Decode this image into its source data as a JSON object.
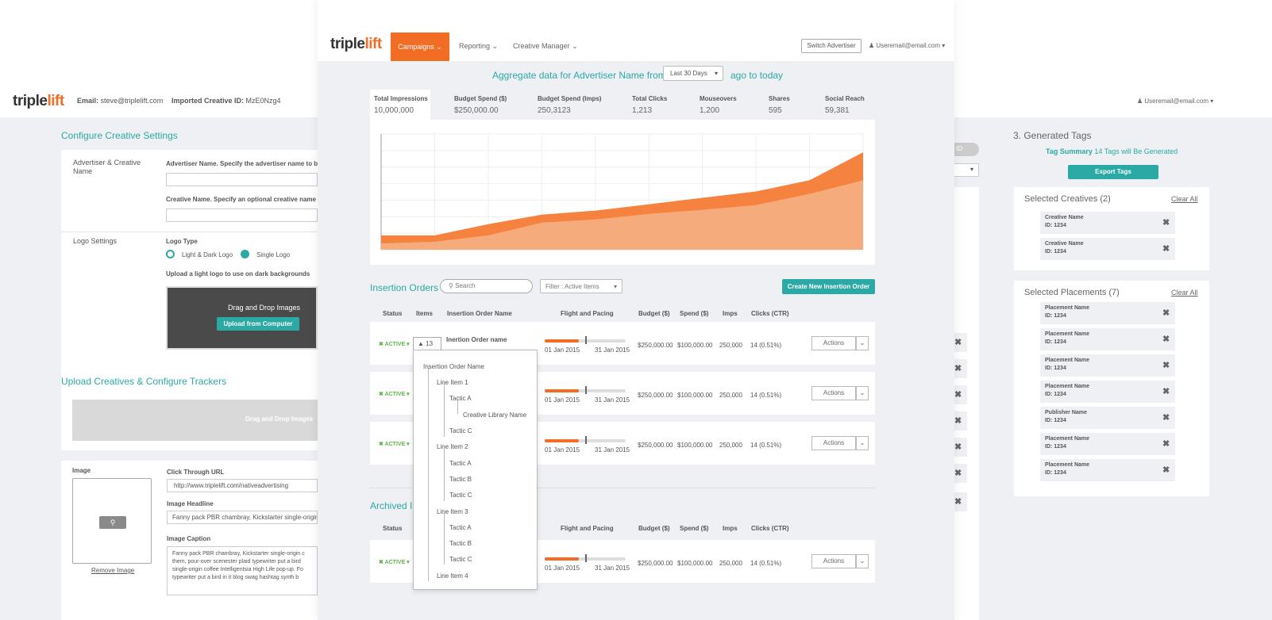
{
  "left_window": {
    "logo_a": "triple",
    "logo_b": "lift",
    "email_label": "Email:",
    "email_value": "steve@triplelift.com",
    "imported_label": "Imported Creative ID:",
    "imported_value": "MzE0Nzg4",
    "section_configure": "Configure Creative Settings",
    "adv_creative_label": "Advertiser & Creative Name",
    "advertiser_name_label": "Advertiser Name. Specify the advertiser name to be",
    "creative_name_label": "Creative Name. Specify an optional creative name to",
    "logo_settings_label": "Logo Settings",
    "logo_type_label": "Logo Type",
    "logo_option_1": "Light & Dark Logo",
    "logo_option_2": "Single Logo",
    "upload_light_label": "Upload a light logo to use on dark backgrounds",
    "drag_drop": "Drag and Drop Images",
    "upload_button": "Upload from Computer",
    "section_upload": "Upload Creatives & Configure Trackers",
    "drag_drop_2": "Drag and Drop Images",
    "image_label": "Image",
    "remove_image": "Remove Image",
    "click_through_label": "Click Through URL",
    "click_through_value": "http://www.triplelift.com/nativeadvertising",
    "headline_label": "Image Headline",
    "headline_value": "Fanny pack PBR chambray, Kickstarter single-origin co",
    "caption_label": "Image Caption",
    "caption_value": "Fanny pack PBR chambray, Kickstarter single-origin c them, pour-over scenester plaid typewriter put a bird single-origin coffee Intelligentsia High Life pop-up. Fo typewriter put a bird in it blog swag hashtag synth b"
  },
  "right_window": {
    "user_email": "Useremail@email.com",
    "section_generated": "3. Generated Tags",
    "tag_summary_label": "Tag Summary",
    "tag_summary_count": "14 Tags will Be Generated",
    "export_button": "Export Tags",
    "id_chip": "ID",
    "selected_creatives_title": "Selected Creatives (2)",
    "clear_all": "Clear All",
    "creatives": [
      {
        "name": "Creative Name",
        "id": "ID: 1234"
      },
      {
        "name": "Creative Name",
        "id": "ID: 1234"
      }
    ],
    "selected_placements_title": "Selected Placements (7)",
    "placements": [
      {
        "name": "Placement Name",
        "id": "ID: 1234"
      },
      {
        "name": "Placement Name",
        "id": "ID: 1234"
      },
      {
        "name": "Placement Name",
        "id": "ID: 1234"
      },
      {
        "name": "Placement Name",
        "id": "ID: 1234"
      },
      {
        "name": "Publisher Name",
        "id": "ID: 1234"
      },
      {
        "name": "Placement Name",
        "id": "ID: 1234"
      },
      {
        "name": "Placement Name",
        "id": "ID: 1234"
      }
    ],
    "remove_glyph": "✖"
  },
  "front": {
    "logo_a": "triple",
    "logo_b": "lift",
    "nav": {
      "campaigns": "Campaigns",
      "reporting": "Reporting",
      "creative_manager": "Creative Manager"
    },
    "switch_advertiser": "Switch Advertiser",
    "user_email": "Useremail@email.com",
    "aggregate_prefix": "Aggregate data for Advertiser Name from",
    "date_range": "Last 30 Days",
    "aggregate_suffix": "ago to today",
    "stats": [
      {
        "label": "Total Impressions",
        "value": "10,000,000"
      },
      {
        "label": "Budget Spend ($)",
        "value": "$250,000.00"
      },
      {
        "label": "Budget Spend (Imps)",
        "value": "250,3123"
      },
      {
        "label": "Total Clicks",
        "value": "1,213"
      },
      {
        "label": "Mouseovers",
        "value": "1,200"
      },
      {
        "label": "Shares",
        "value": "595"
      },
      {
        "label": "Social Reach",
        "value": "59,381"
      }
    ],
    "insertion_orders_title": "Insertion Orders",
    "search_placeholder": "Search",
    "filter_label": "Filter : Active Items",
    "create_button": "Create New Insertion Order",
    "columns": {
      "status": "Status",
      "items": "Items",
      "io_name": "Insertion Order Name",
      "flight": "Flight and Pacing",
      "budget": "Budget ($)",
      "spend": "Spend ($)",
      "imps": "Imps",
      "clicks": "Clicks (CTR)"
    },
    "rows": [
      {
        "status": "ACTIVE",
        "items": "13",
        "name": "Inertion Order name",
        "start": "01 Jan 2015",
        "end": "31 Jan 2015",
        "budget": "$250,000.00",
        "spend": "$100,000.00",
        "imps": "250,000",
        "clicks": "14 (0.51%)",
        "actions": "Actions",
        "pacing": 0.42
      },
      {
        "status": "ACTIVE",
        "start": "01 Jan 2015",
        "end": "31 Jan 2015",
        "budget": "$250,000.00",
        "spend": "$100,000.00",
        "imps": "250,000",
        "clicks": "14 (0.51%)",
        "actions": "Actions",
        "pacing": 0.42
      },
      {
        "status": "ACTIVE",
        "start": "01 Jan 2015",
        "end": "31 Jan 2015",
        "budget": "$250,000.00",
        "spend": "$100,000.00",
        "imps": "250,000",
        "clicks": "14 (0.51%)",
        "actions": "Actions",
        "pacing": 0.42
      }
    ],
    "archived_title": "Archived In",
    "archived_row": {
      "status": "ACTIVE",
      "start": "01 Jan 2015",
      "end": "31 Jan 2015",
      "budget": "$250,000.00",
      "spend": "$100,000.00",
      "imps": "250,000",
      "clicks": "14 (0.51%)",
      "actions": "Actions",
      "pacing": 0.42
    },
    "tree": {
      "root": "Insertion Order Name",
      "line_item_1": "Line Item 1",
      "tactic_a_1": "Tactic A",
      "creative_library": "Creative Library Name",
      "tactic_c_1": "Tactic C",
      "line_item_2": "Line Item 2",
      "tactic_a_2": "Tactic A",
      "tactic_b_2": "Tactic B",
      "tactic_c_2": "Tactic C",
      "line_item_3": "Line Item 3",
      "tactic_a_3": "Tactic A",
      "tactic_b_3": "Tactic B",
      "tactic_c_3": "Tactic C",
      "line_item_4": "Line Item 4"
    }
  },
  "colors": {
    "brand_orange": "#f26c24",
    "teal": "#2ba9a4",
    "active_green": "#5fb44b"
  },
  "chart_data": {
    "type": "area",
    "x": [
      0,
      1,
      2,
      3,
      4,
      5,
      6,
      7,
      8,
      9
    ],
    "series": [
      {
        "values": [
          18,
          18,
          32,
          44,
          49,
          57,
          65,
          73,
          87,
          122
        ]
      },
      {
        "values": [
          8,
          10,
          18,
          34,
          38,
          45,
          50,
          56,
          70,
          87
        ]
      }
    ],
    "ylim": [
      0,
      145
    ],
    "grid": true,
    "legend": "none"
  }
}
